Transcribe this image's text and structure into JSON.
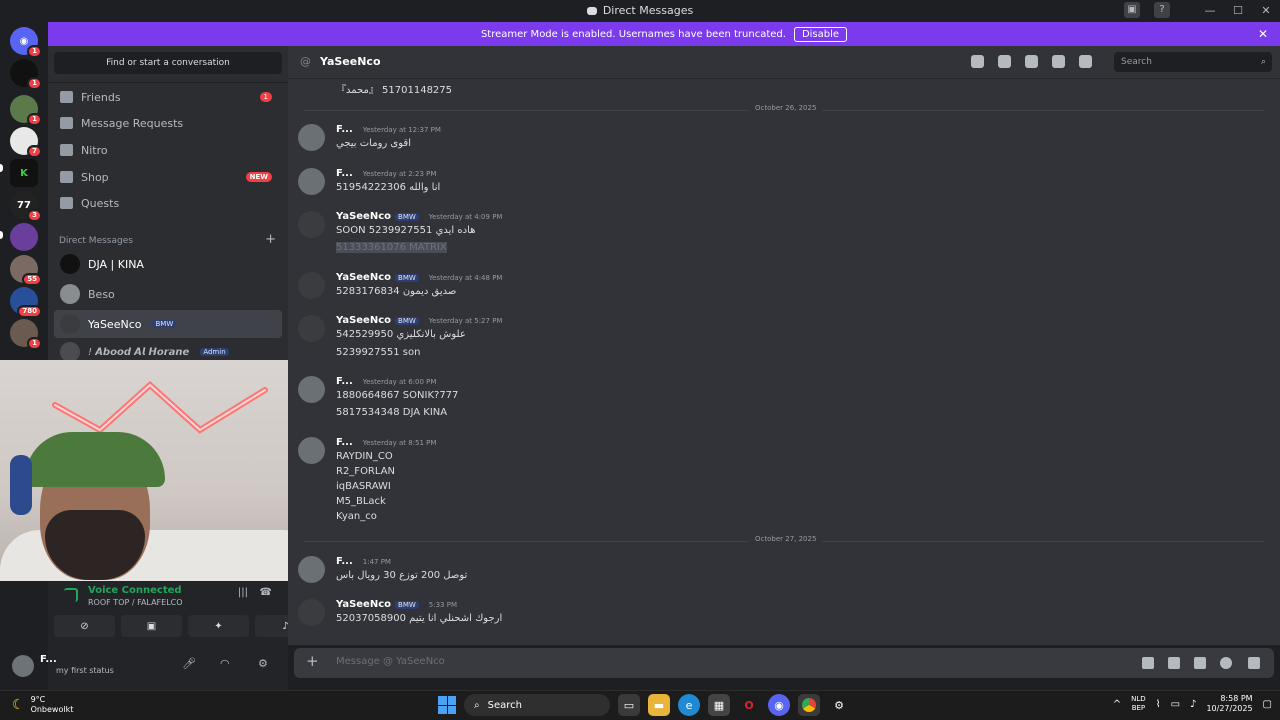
{
  "window": {
    "title": "Direct Messages",
    "controls": [
      "—",
      "☐",
      "✕"
    ]
  },
  "banner": {
    "text": "Streamer Mode is enabled. Usernames have been truncated.",
    "disable_label": "Disable"
  },
  "server_rail": {
    "badges": [
      "1",
      "1",
      "1",
      "7",
      "3",
      "55",
      "780",
      "1"
    ],
    "badge_77": "77"
  },
  "sidebar": {
    "find_label": "Find or start a conversation",
    "nav": [
      {
        "label": "Friends",
        "badge": "1"
      },
      {
        "label": "Message Requests"
      },
      {
        "label": "Nitro"
      },
      {
        "label": "Shop",
        "badge": "NEW"
      },
      {
        "label": "Quests"
      }
    ],
    "dm_header": "Direct Messages",
    "dms": [
      {
        "name": "DJA | KINA"
      },
      {
        "name": "Beso"
      },
      {
        "name": "YaSeeNco",
        "tag": "BMW"
      },
      {
        "name": "! 𝘼𝙗𝙤𝙤𝙙 𝘼𝙡 𝙃𝙤𝙧𝙖𝙣𝙚",
        "tag": "Admin"
      }
    ]
  },
  "voice": {
    "status": "Voice Connected",
    "channel": "ROOF TOP / FALAFELCO"
  },
  "user": {
    "name": "F...",
    "status": "my first status"
  },
  "chat": {
    "recipient": "YaSeeNco",
    "search_placeholder": "Search",
    "top_line": "『محمد』 51701148275",
    "date1": "October 26, 2025",
    "date2": "October 27, 2025",
    "messages": [
      {
        "author": "F...",
        "time": "Yesterday at 12:37 PM",
        "lines": [
          "اقوى رومات بيجي"
        ]
      },
      {
        "author": "F...",
        "time": "Yesterday at 2:23 PM",
        "lines": [
          "51954222306 انا والله"
        ]
      },
      {
        "author": "YaSeeNco",
        "badge": "BMW",
        "time": "Yesterday at 4:09 PM",
        "lines": [
          "SOON 5239927551 هاده ايدي",
          "51333361076 MATRIX"
        ]
      },
      {
        "author": "YaSeeNco",
        "badge": "BMW",
        "time": "Yesterday at 4:48 PM",
        "lines": [
          "5283176834 صديق ديمون"
        ]
      },
      {
        "author": "YaSeeNco",
        "badge": "BMW",
        "time": "Yesterday at 5:27 PM",
        "lines": [
          "542529950 علوش بالانكليزي",
          "5239927551 son"
        ]
      },
      {
        "author": "F...",
        "time": "Yesterday at 6:00 PM",
        "lines": [
          "1880664867 SONIK?777",
          "5817534348 DJA KINA"
        ]
      },
      {
        "author": "F...",
        "time": "Yesterday at 8:51 PM",
        "lines": [
          "RAYDIN_CO",
          "R2_FORLAN",
          "iqBASRAWI",
          "M5_BLack",
          "Kyan_co"
        ]
      },
      {
        "author": "F...",
        "time": "1:47 PM",
        "lines": [
          "توصل 200 توزع 30 رويال باس"
        ]
      },
      {
        "author": "YaSeeNco",
        "badge": "BMW",
        "time": "5:33 PM",
        "lines": [
          "52037058900 ارجوك اشحنلي انا يتيم"
        ]
      }
    ],
    "composer_placeholder": "Message @ YaSeeNco"
  },
  "taskbar": {
    "temp": "9°C",
    "weather": "Onbewolkt",
    "search": "Search",
    "lang1": "NLD",
    "lang2": "BEP",
    "time": "8:58 PM",
    "date": "10/27/2025"
  },
  "colors": {
    "accent": "#7c3aed",
    "bg_chat": "#313338",
    "bg_side": "#2b2d31",
    "green": "#23a55a",
    "red": "#f23f43"
  }
}
